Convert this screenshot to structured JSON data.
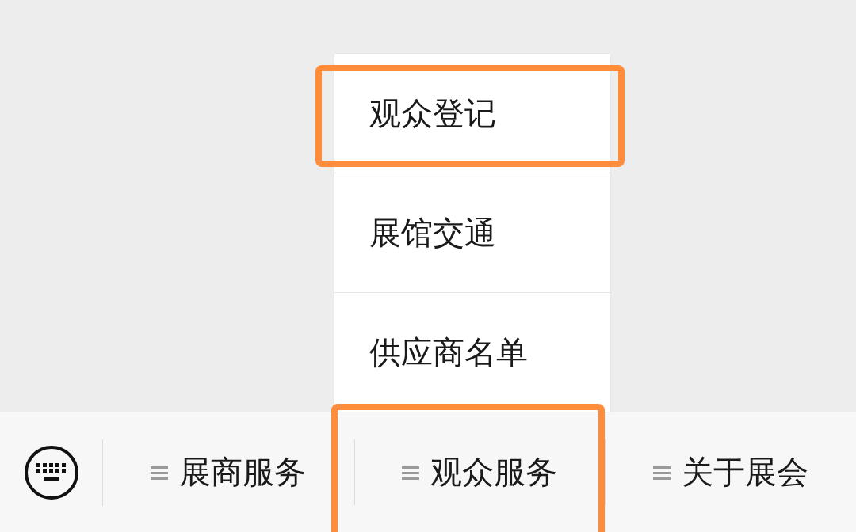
{
  "popup_menu": {
    "items": [
      {
        "label": "观众登记",
        "highlighted": true
      },
      {
        "label": "展馆交通",
        "highlighted": false
      },
      {
        "label": "供应商名单",
        "highlighted": false
      }
    ]
  },
  "bottom_menu": {
    "tabs": [
      {
        "label": "展商服务",
        "highlighted": false
      },
      {
        "label": "观众服务",
        "highlighted": true
      },
      {
        "label": "关于展会",
        "highlighted": false
      }
    ]
  }
}
